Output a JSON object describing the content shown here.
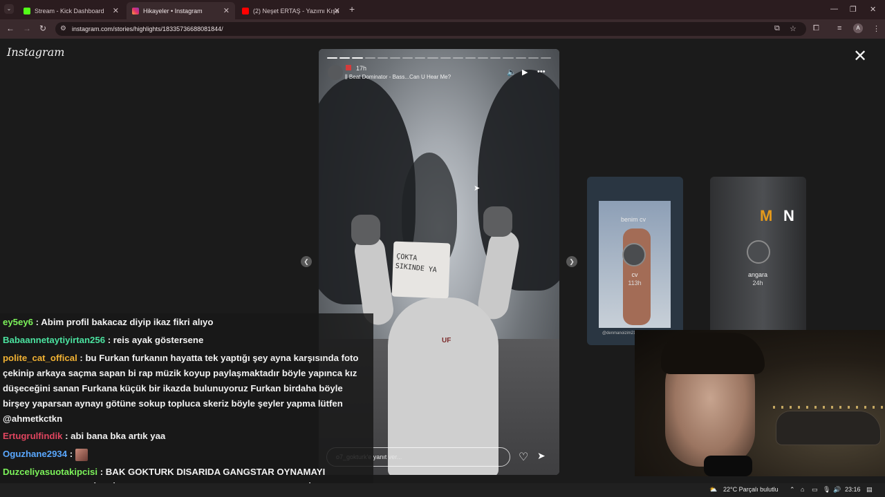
{
  "browser": {
    "tabs": [
      {
        "title": "Stream - Kick Dashboard",
        "icon": "kick-icon",
        "color": "#53fc18"
      },
      {
        "title": "Hikayeler • Instagram",
        "icon": "instagram-icon",
        "color": "#e1306c"
      },
      {
        "title": "(2) Neşet ERTAŞ - Yazımı Kışa Ç",
        "icon": "youtube-icon",
        "color": "#ff0000"
      }
    ],
    "url": "instagram.com/stories/highlights/18335736688081844/",
    "profile_initial": "A"
  },
  "instagram": {
    "logo": "Instagram",
    "story": {
      "time": "17h",
      "music": "Beat Dominator - Bass...Can U Hear Me?",
      "sign_text": "ÇOKTA SIKINDE YA",
      "reply_placeholder": "o7_gokturk'e yanıt ver...",
      "segments_total": 18,
      "segments_done": 3
    },
    "previews": [
      {
        "caption": "benim cv",
        "label": "cv",
        "time": "113h",
        "handle": "@denmanoizim21"
      },
      {
        "label": "angara",
        "time": "24h",
        "logo_left": "M",
        "logo_right": "N"
      }
    ]
  },
  "chat": [
    {
      "user": "ey5ey6",
      "color": "#7cf25a",
      "message": " : Abim profil bakacaz diyip ikaz fikri alıyo"
    },
    {
      "user": "Babaannetaytiyirtan256",
      "color": "#4be3a0",
      "message": " : reis ayak göstersene"
    },
    {
      "user": "polite_cat_offical",
      "color": "#f2b233",
      "message": " : bu Furkan furkanın hayatta tek yaptığı şey ayna karşısında foto çekinip arkaya saçma sapan bi rap müzik koyup paylaşmaktadır böyle yapınca kız düşeceğini sanan Furkana küçük bir ikazda bulunuyoruz Furkan birdaha böyle birşey yaparsan aynayı götüne sokup topluca skeriz böyle şeyler yapma lütfen @ahmetkctkn"
    },
    {
      "user": "Ertugrulfindik",
      "color": "#e0455f",
      "message": " : abi bana bka artık yaa"
    },
    {
      "user": "Oguzhane2934",
      "color": "#5aa8ff",
      "message": " : "
    },
    {
      "user": "Duzceliyasuotakipcisi",
      "color": "#7cf25a",
      "message": " : BAK GOKTURK DISARIDA GANGSTAR OYNAMAYI BIRAKTA BABANA ÇİFTLİKTE YARDIM ET YOKSA ABLANI 9 KOYDE GİSE"
    }
  ],
  "taskbar": {
    "weather": "22°C  Parçalı bulutlu",
    "clock": "23:16"
  }
}
